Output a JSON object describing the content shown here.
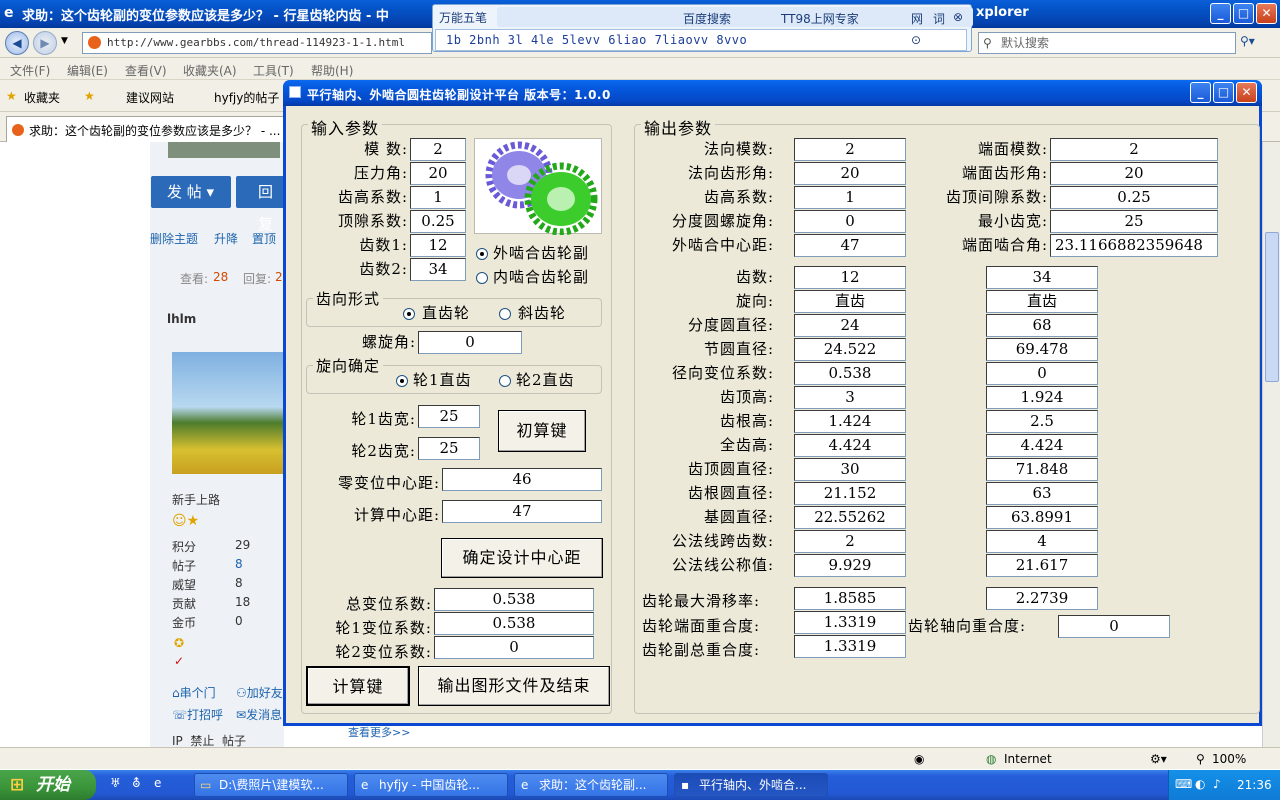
{
  "browser": {
    "title": "求助：这个齿轮副的变位参数应该是多少？ - 行星齿轮内齿 - 中",
    "title_tail": "xplorer",
    "url": "http://www.gearbbs.com/thread-114923-1-1.html",
    "search_placeholder": "默认搜索",
    "menu": [
      "文件(F)",
      "编辑(E)",
      "查看(V)",
      "收藏夹(A)",
      "工具(T)",
      "帮助(H)"
    ],
    "favorites": {
      "label": "收藏夹",
      "items": [
        "建议网站",
        "hyfjy的帖子"
      ]
    },
    "tab_title": "求助：这个齿轮副的变位参数应该是多少？ - ..."
  },
  "ime": {
    "name": "万能五笔",
    "tabs": [
      "百度搜索",
      "TT98上网专家",
      "网",
      "词"
    ],
    "candidates": "1b 2bnh 3l 4le 5levv 6liao 7liaovv 8vvo"
  },
  "webpage": {
    "post_button": "发 帖",
    "reply_button": "回复",
    "actions": [
      "删除主题",
      "升降",
      "置顶"
    ],
    "views_label": "查看:",
    "views": "28",
    "replies_label": "回复:",
    "replies": "2",
    "username": "lhlm",
    "rank": "新手上路",
    "stats": [
      {
        "label": "积分",
        "value": "29"
      },
      {
        "label": "帖子",
        "value": "8"
      },
      {
        "label": "威望",
        "value": "8"
      },
      {
        "label": "贡献",
        "value": "18"
      },
      {
        "label": "金币",
        "value": "0"
      }
    ],
    "links": [
      "串个门",
      "加好友",
      "打招呼",
      "发消息"
    ],
    "footer": "IP  禁止  帖子",
    "more": "查看更多>>"
  },
  "status": {
    "zone": "Internet",
    "zoom": "100%"
  },
  "taskbar": {
    "start": "开始",
    "tasks": [
      "D:\\费照片\\建模软...",
      "hyfjy - 中国齿轮...",
      "求助：这个齿轮副...",
      "平行轴内、外啮合..."
    ],
    "clock": "21:36"
  },
  "app": {
    "title": "平行轴内、外啮合圆柱齿轮副设计平台  版本号：1.0.0",
    "input": {
      "legend": "输入参数",
      "module_label": "模  数:",
      "module": "2",
      "pressure_label": "压力角:",
      "pressure": "20",
      "addendum_label": "齿高系数:",
      "addendum": "1",
      "clearance_label": "顶隙系数:",
      "clearance": "0.25",
      "z1_label": "齿数1:",
      "z1": "12",
      "z2_label": "齿数2:",
      "z2": "34",
      "mesh_external": "外啮合齿轮副",
      "mesh_internal": "内啮合齿轮副",
      "tooth_form_legend": "齿向形式",
      "spur": "直齿轮",
      "helical": "斜齿轮",
      "helix_label": "螺旋角:",
      "helix": "0",
      "hand_legend": "旋向确定",
      "hand1": "轮1直齿",
      "hand2": "轮2直齿",
      "width1_label": "轮1齿宽:",
      "width1": "25",
      "width2_label": "轮2齿宽:",
      "width2": "25",
      "calc_initial": "初算键",
      "zero_center_label": "零变位中心距:",
      "zero_center": "46",
      "calc_center_label": "计算中心距:",
      "calc_center": "47",
      "confirm_center": "确定设计中心距",
      "total_shift_label": "总变位系数:",
      "total_shift": "0.538",
      "shift1_label": "轮1变位系数:",
      "shift1": "0.538",
      "shift2_label": "轮2变位系数:",
      "shift2": "0",
      "calc_button": "计算键",
      "export_button": "输出图形文件及结束"
    },
    "output": {
      "legend": "输出参数",
      "left_params": [
        {
          "label": "法向模数:",
          "value": "2"
        },
        {
          "label": "法向齿形角:",
          "value": "20"
        },
        {
          "label": "齿高系数:",
          "value": "1"
        },
        {
          "label": "分度圆螺旋角:",
          "value": "0"
        },
        {
          "label": "外啮合中心距:",
          "value": "47"
        }
      ],
      "right_params": [
        {
          "label": "端面模数:",
          "value": "2"
        },
        {
          "label": "端面齿形角:",
          "value": "20"
        },
        {
          "label": "齿顶间隙系数:",
          "value": "0.25"
        },
        {
          "label": "最小齿宽:",
          "value": "25"
        },
        {
          "label": "端面啮合角:",
          "value": "23.1166882359648"
        }
      ],
      "rows": [
        {
          "label": "齿数:",
          "g1": "12",
          "g2": "34"
        },
        {
          "label": "旋向:",
          "g1": "直齿",
          "g2": "直齿"
        },
        {
          "label": "分度圆直径:",
          "g1": "24",
          "g2": "68"
        },
        {
          "label": "节圆直径:",
          "g1": "24.522",
          "g2": "69.478"
        },
        {
          "label": "径向变位系数:",
          "g1": "0.538",
          "g2": "0"
        },
        {
          "label": "齿顶高:",
          "g1": "3",
          "g2": "1.924"
        },
        {
          "label": "齿根高:",
          "g1": "1.424",
          "g2": "2.5"
        },
        {
          "label": "全齿高:",
          "g1": "4.424",
          "g2": "4.424"
        },
        {
          "label": "齿顶圆直径:",
          "g1": "30",
          "g2": "71.848"
        },
        {
          "label": "齿根圆直径:",
          "g1": "21.152",
          "g2": "63"
        },
        {
          "label": "基圆直径:",
          "g1": "22.55262",
          "g2": "63.8991"
        },
        {
          "label": "公法线跨齿数:",
          "g1": "2",
          "g2": "4"
        },
        {
          "label": "公法线公称值:",
          "g1": "9.929",
          "g2": "21.617"
        }
      ],
      "slip_label": "齿轮最大滑移率:",
      "slip1": "1.8585",
      "slip2": "2.2739",
      "transverse_label": "齿轮端面重合度:",
      "transverse": "1.3319",
      "axial_label": "齿轮轴向重合度:",
      "axial": "0",
      "total_label": "齿轮副总重合度:",
      "total": "1.3319"
    }
  }
}
